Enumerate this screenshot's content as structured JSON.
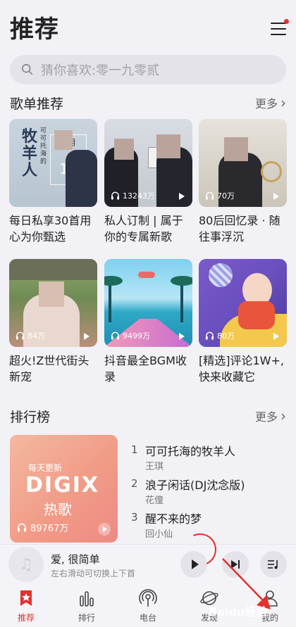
{
  "header": {
    "title": "推荐"
  },
  "search": {
    "placeholder": "猜你喜欢:零一九零贰"
  },
  "playlists_section": {
    "title": "歌单推荐",
    "more": "更多"
  },
  "playlists": [
    {
      "title": "每日私享30首用心为你甄选",
      "cover_text": "16",
      "cover_small": "二月",
      "cover_vertical": "牧羊人",
      "cover_label": "可可托海的"
    },
    {
      "title": "私人订制 | 属于你的专属新歌",
      "plays": "13243万"
    },
    {
      "title": "80后回忆录 · 随往事浮沉",
      "plays": "70万"
    },
    {
      "title": "超火!Z世代街头新宠",
      "plays": "84万"
    },
    {
      "title": "抖音最全BGM收录",
      "plays": "9499万"
    },
    {
      "title": "[精选]评论1W+,快来收藏它",
      "plays": "80万"
    }
  ],
  "ranking_section": {
    "title": "排行榜",
    "more": "更多"
  },
  "ranking_cover": {
    "tag": "每天更新",
    "brand": "DIGIX",
    "name": "热歌",
    "plays": "89767万"
  },
  "ranking": [
    {
      "num": "1",
      "song": "可可托海的牧羊人",
      "artist": "王琪"
    },
    {
      "num": "2",
      "song": "浪子闲话(DJ沈念版)",
      "artist": "花僮"
    },
    {
      "num": "3",
      "song": "醒不来的梦",
      "artist": "回小仙"
    }
  ],
  "player": {
    "song": "爱, 很简单",
    "hint": "左右滑动可切换上下首"
  },
  "tabs": [
    {
      "label": "推荐",
      "icon": "star-bookmark-icon",
      "active": true
    },
    {
      "label": "排行",
      "icon": "bars-icon"
    },
    {
      "label": "电台",
      "icon": "radio-icon"
    },
    {
      "label": "发现",
      "icon": "planet-icon"
    },
    {
      "label": "我的",
      "icon": "person-icon"
    }
  ],
  "watermark": "Baidu经验",
  "colors": {
    "accent": "#e3312d",
    "background": "#f2f1f6"
  }
}
